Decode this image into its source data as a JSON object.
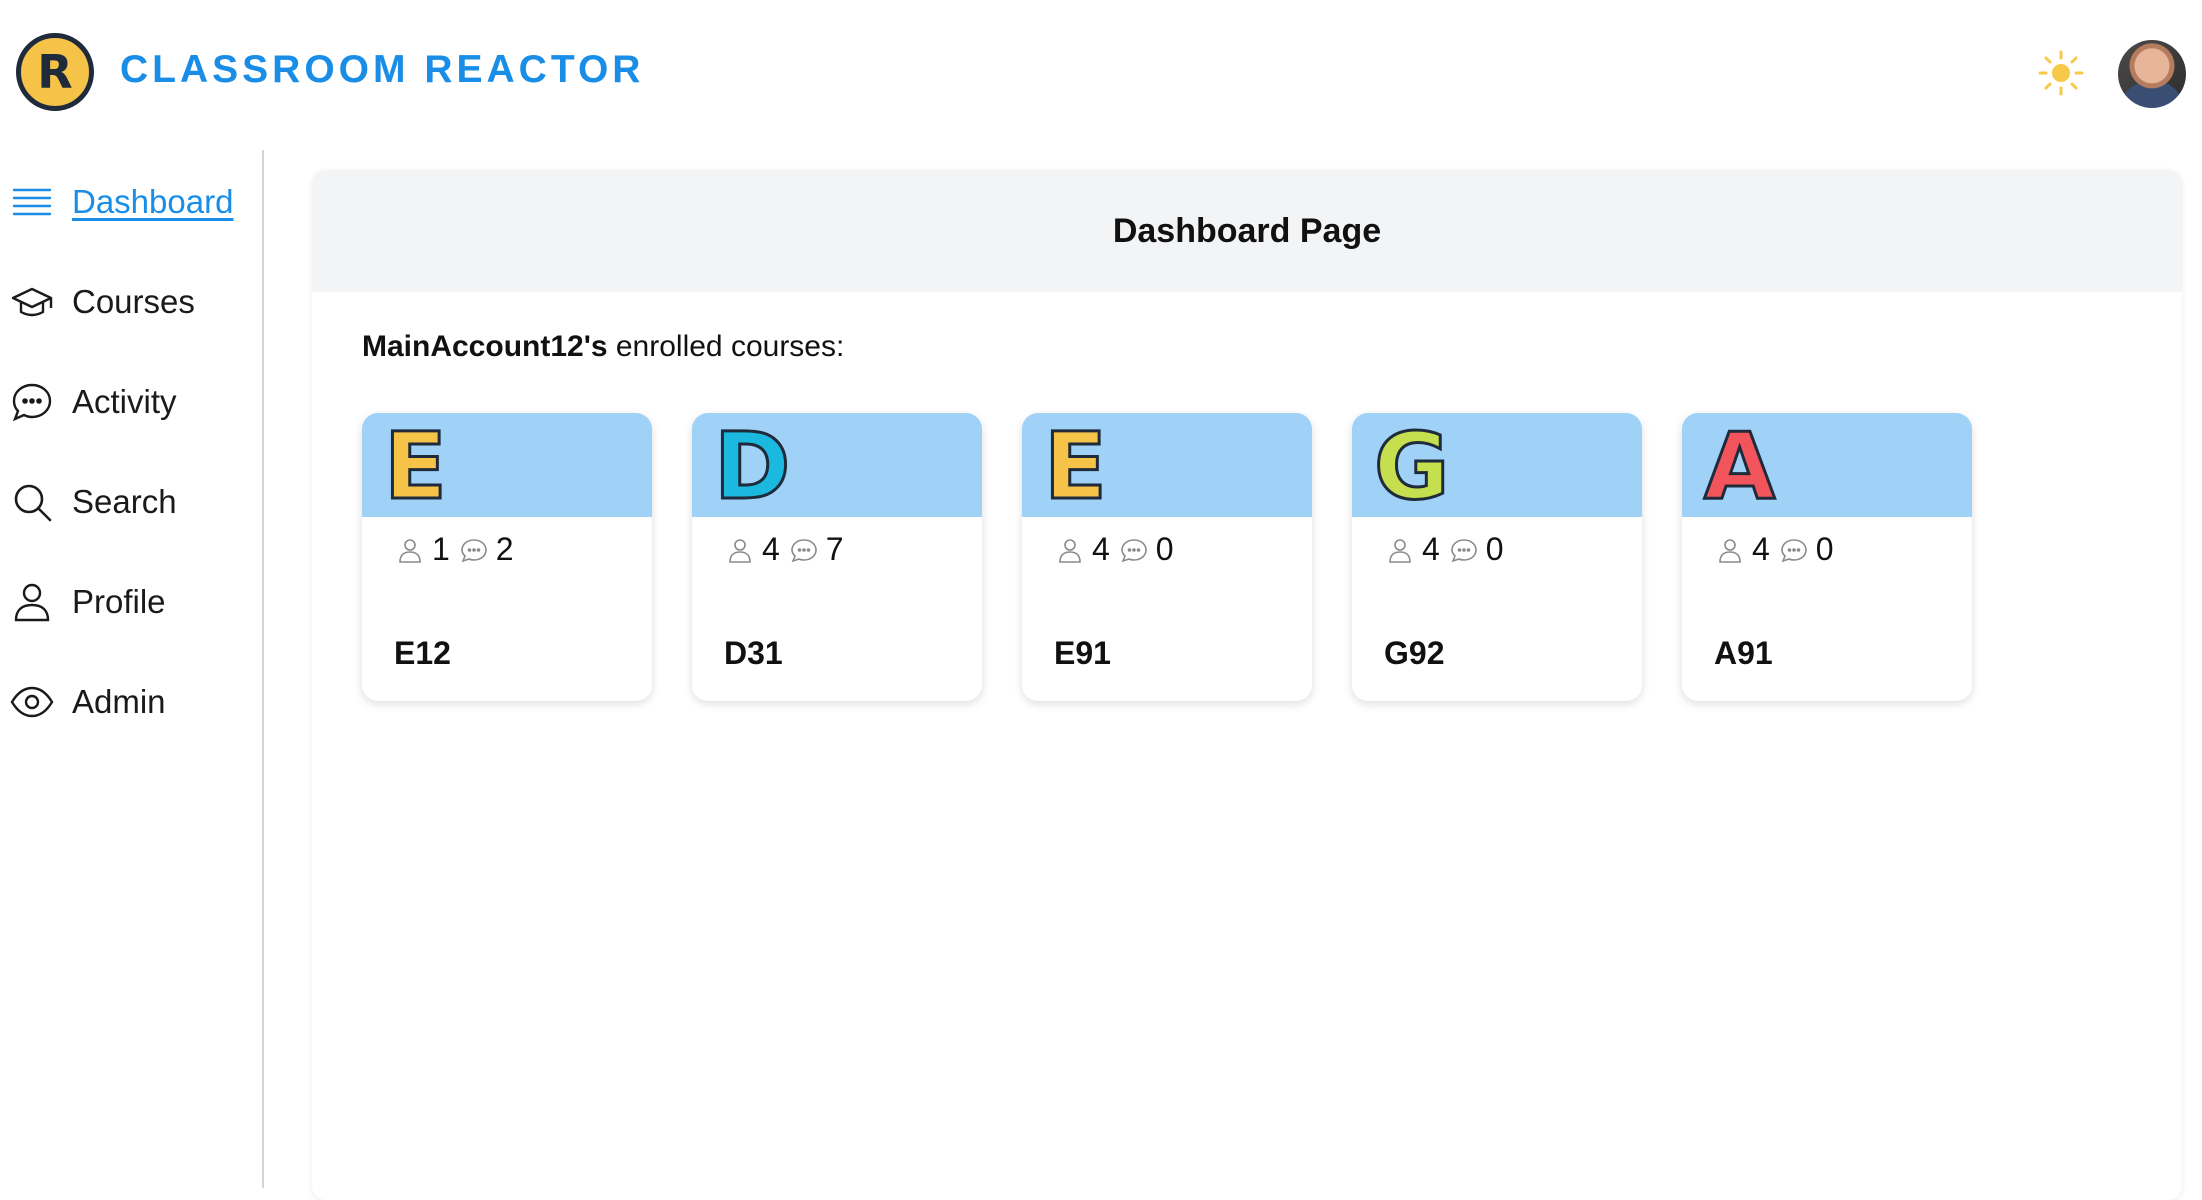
{
  "app": {
    "logo_letter": "R",
    "title": "CLASSROOM REACTOR"
  },
  "header": {
    "theme_icon": "sun-icon",
    "avatar": "user-avatar"
  },
  "sidebar": {
    "items": [
      {
        "label": "Dashboard",
        "icon": "menu-lines-icon",
        "active": true
      },
      {
        "label": "Courses",
        "icon": "graduation-cap-icon",
        "active": false
      },
      {
        "label": "Activity",
        "icon": "chat-bubble-icon",
        "active": false
      },
      {
        "label": "Search",
        "icon": "search-icon",
        "active": false
      },
      {
        "label": "Profile",
        "icon": "user-icon",
        "active": false
      },
      {
        "label": "Admin",
        "icon": "eye-icon",
        "active": false
      }
    ]
  },
  "main": {
    "title": "Dashboard Page",
    "username": "MainAccount12's",
    "enrolled_text": " enrolled courses:",
    "courses": [
      {
        "letter": "E",
        "letter_color": "#f6c349",
        "members": "1",
        "comments": "2",
        "code": "E12"
      },
      {
        "letter": "D",
        "letter_color": "#1bb8e0",
        "members": "4",
        "comments": "7",
        "code": "D31"
      },
      {
        "letter": "E",
        "letter_color": "#f6c349",
        "members": "4",
        "comments": "0",
        "code": "E91"
      },
      {
        "letter": "G",
        "letter_color": "#c6df4f",
        "members": "4",
        "comments": "0",
        "code": "G92"
      },
      {
        "letter": "A",
        "letter_color": "#f2545b",
        "members": "4",
        "comments": "0",
        "code": "A91"
      }
    ]
  },
  "colors": {
    "accent": "#1a8ee6",
    "banner": "#a0d2f8",
    "panel_header": "#f3f4f6"
  }
}
